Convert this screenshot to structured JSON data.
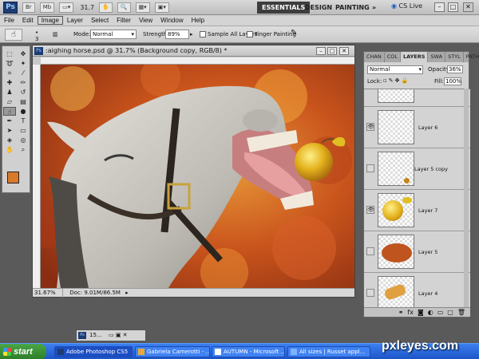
{
  "appbar": {
    "logo": "Ps",
    "btn_br": "Br",
    "btn_mb": "Mb",
    "zoom": "31.7",
    "workspaces": [
      "ESSENTIALS",
      "DESIGN",
      "PAINTING"
    ],
    "more": "»",
    "cslive": "CS Live",
    "win_controls": [
      "–",
      "□",
      "✕"
    ]
  },
  "menu": {
    "items": [
      "File",
      "Edit",
      "Image",
      "Layer",
      "Select",
      "Filter",
      "View",
      "Window",
      "Help"
    ],
    "active": "Image"
  },
  "options": {
    "brush_size": "3",
    "mode_label": "Mode:",
    "mode_value": "Normal",
    "strength_label": "Strength:",
    "strength_value": "89%",
    "sample_all_layers": "Sample All Layers",
    "finger_painting": "Finger Painting"
  },
  "document": {
    "title": ":aighing horse.psd @ 31.7% (Background copy, RGB/8) *",
    "zoom_status": "31.67%",
    "doc_size": "Doc: 9.01M/86.5M"
  },
  "colors": {
    "foreground": "#d97a2b",
    "background": "#ffffff"
  },
  "panel": {
    "tabs": [
      "CHAN",
      "COL",
      "LAYERS",
      "SWA",
      "STYL",
      "PATH"
    ],
    "active_tab": "LAYERS",
    "blend_mode": "Normal",
    "opacity_label": "Opacity:",
    "opacity_value": "36%",
    "lock_label": "Lock:",
    "fill_label": "Fill:",
    "fill_value": "100%",
    "layers": [
      {
        "name": "",
        "visible": false
      },
      {
        "name": "Layer 6",
        "visible": true
      },
      {
        "name": "Layer 5 copy",
        "visible": false
      },
      {
        "name": "Layer 7",
        "visible": true
      },
      {
        "name": "Layer 5",
        "visible": false
      },
      {
        "name": "Layer 4",
        "visible": false
      }
    ]
  },
  "minimized_doc": {
    "label": "15..."
  },
  "taskbar": {
    "start": "start",
    "tasks": [
      "Adobe Photoshop CS5",
      "Gabriela Camerotti - ...",
      "AUTUMN - Microsoft ...",
      "All sizes | Russet appl..."
    ]
  },
  "watermark": "pxleyes.com"
}
